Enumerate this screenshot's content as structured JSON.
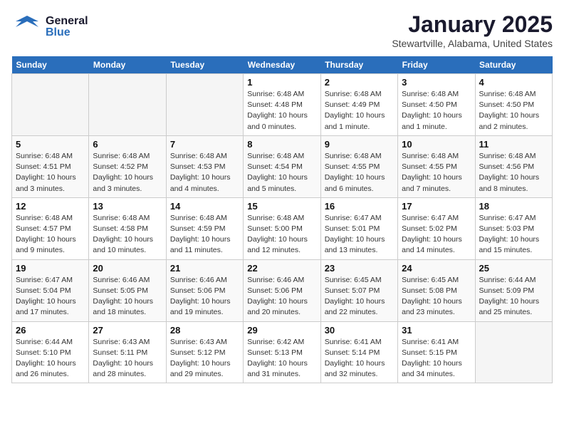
{
  "logo": {
    "line1": "General",
    "line2": "Blue"
  },
  "title": "January 2025",
  "subtitle": "Stewartville, Alabama, United States",
  "days_of_week": [
    "Sunday",
    "Monday",
    "Tuesday",
    "Wednesday",
    "Thursday",
    "Friday",
    "Saturday"
  ],
  "weeks": [
    [
      {
        "day": "",
        "info": ""
      },
      {
        "day": "",
        "info": ""
      },
      {
        "day": "",
        "info": ""
      },
      {
        "day": "1",
        "info": "Sunrise: 6:48 AM\nSunset: 4:48 PM\nDaylight: 10 hours\nand 0 minutes."
      },
      {
        "day": "2",
        "info": "Sunrise: 6:48 AM\nSunset: 4:49 PM\nDaylight: 10 hours\nand 1 minute."
      },
      {
        "day": "3",
        "info": "Sunrise: 6:48 AM\nSunset: 4:50 PM\nDaylight: 10 hours\nand 1 minute."
      },
      {
        "day": "4",
        "info": "Sunrise: 6:48 AM\nSunset: 4:50 PM\nDaylight: 10 hours\nand 2 minutes."
      }
    ],
    [
      {
        "day": "5",
        "info": "Sunrise: 6:48 AM\nSunset: 4:51 PM\nDaylight: 10 hours\nand 3 minutes."
      },
      {
        "day": "6",
        "info": "Sunrise: 6:48 AM\nSunset: 4:52 PM\nDaylight: 10 hours\nand 3 minutes."
      },
      {
        "day": "7",
        "info": "Sunrise: 6:48 AM\nSunset: 4:53 PM\nDaylight: 10 hours\nand 4 minutes."
      },
      {
        "day": "8",
        "info": "Sunrise: 6:48 AM\nSunset: 4:54 PM\nDaylight: 10 hours\nand 5 minutes."
      },
      {
        "day": "9",
        "info": "Sunrise: 6:48 AM\nSunset: 4:55 PM\nDaylight: 10 hours\nand 6 minutes."
      },
      {
        "day": "10",
        "info": "Sunrise: 6:48 AM\nSunset: 4:55 PM\nDaylight: 10 hours\nand 7 minutes."
      },
      {
        "day": "11",
        "info": "Sunrise: 6:48 AM\nSunset: 4:56 PM\nDaylight: 10 hours\nand 8 minutes."
      }
    ],
    [
      {
        "day": "12",
        "info": "Sunrise: 6:48 AM\nSunset: 4:57 PM\nDaylight: 10 hours\nand 9 minutes."
      },
      {
        "day": "13",
        "info": "Sunrise: 6:48 AM\nSunset: 4:58 PM\nDaylight: 10 hours\nand 10 minutes."
      },
      {
        "day": "14",
        "info": "Sunrise: 6:48 AM\nSunset: 4:59 PM\nDaylight: 10 hours\nand 11 minutes."
      },
      {
        "day": "15",
        "info": "Sunrise: 6:48 AM\nSunset: 5:00 PM\nDaylight: 10 hours\nand 12 minutes."
      },
      {
        "day": "16",
        "info": "Sunrise: 6:47 AM\nSunset: 5:01 PM\nDaylight: 10 hours\nand 13 minutes."
      },
      {
        "day": "17",
        "info": "Sunrise: 6:47 AM\nSunset: 5:02 PM\nDaylight: 10 hours\nand 14 minutes."
      },
      {
        "day": "18",
        "info": "Sunrise: 6:47 AM\nSunset: 5:03 PM\nDaylight: 10 hours\nand 15 minutes."
      }
    ],
    [
      {
        "day": "19",
        "info": "Sunrise: 6:47 AM\nSunset: 5:04 PM\nDaylight: 10 hours\nand 17 minutes."
      },
      {
        "day": "20",
        "info": "Sunrise: 6:46 AM\nSunset: 5:05 PM\nDaylight: 10 hours\nand 18 minutes."
      },
      {
        "day": "21",
        "info": "Sunrise: 6:46 AM\nSunset: 5:06 PM\nDaylight: 10 hours\nand 19 minutes."
      },
      {
        "day": "22",
        "info": "Sunrise: 6:46 AM\nSunset: 5:06 PM\nDaylight: 10 hours\nand 20 minutes."
      },
      {
        "day": "23",
        "info": "Sunrise: 6:45 AM\nSunset: 5:07 PM\nDaylight: 10 hours\nand 22 minutes."
      },
      {
        "day": "24",
        "info": "Sunrise: 6:45 AM\nSunset: 5:08 PM\nDaylight: 10 hours\nand 23 minutes."
      },
      {
        "day": "25",
        "info": "Sunrise: 6:44 AM\nSunset: 5:09 PM\nDaylight: 10 hours\nand 25 minutes."
      }
    ],
    [
      {
        "day": "26",
        "info": "Sunrise: 6:44 AM\nSunset: 5:10 PM\nDaylight: 10 hours\nand 26 minutes."
      },
      {
        "day": "27",
        "info": "Sunrise: 6:43 AM\nSunset: 5:11 PM\nDaylight: 10 hours\nand 28 minutes."
      },
      {
        "day": "28",
        "info": "Sunrise: 6:43 AM\nSunset: 5:12 PM\nDaylight: 10 hours\nand 29 minutes."
      },
      {
        "day": "29",
        "info": "Sunrise: 6:42 AM\nSunset: 5:13 PM\nDaylight: 10 hours\nand 31 minutes."
      },
      {
        "day": "30",
        "info": "Sunrise: 6:41 AM\nSunset: 5:14 PM\nDaylight: 10 hours\nand 32 minutes."
      },
      {
        "day": "31",
        "info": "Sunrise: 6:41 AM\nSunset: 5:15 PM\nDaylight: 10 hours\nand 34 minutes."
      },
      {
        "day": "",
        "info": ""
      }
    ]
  ]
}
